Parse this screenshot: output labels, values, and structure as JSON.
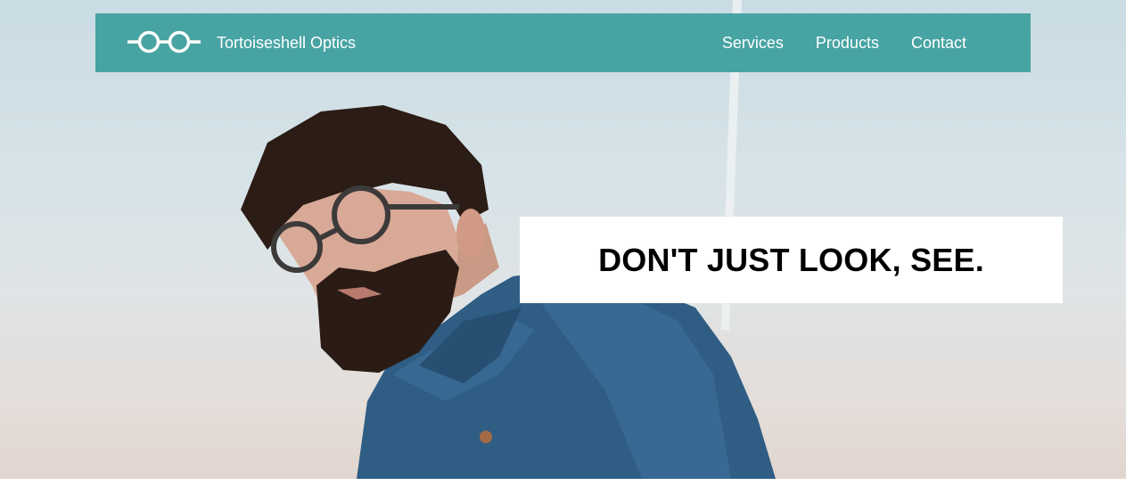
{
  "brand": {
    "name": "Tortoiseshell Optics",
    "logo_icon": "glasses-icon"
  },
  "nav": {
    "items": [
      {
        "label": "Services"
      },
      {
        "label": "Products"
      },
      {
        "label": "Contact"
      }
    ]
  },
  "hero": {
    "tagline": "DON'T JUST LOOK, SEE.",
    "image": "man-wearing-round-glasses-photo"
  },
  "colors": {
    "navbar": "#48a3a3",
    "nav_text": "#ffffff",
    "tagline_box": "#ffffff",
    "tagline_text": "#000000"
  }
}
